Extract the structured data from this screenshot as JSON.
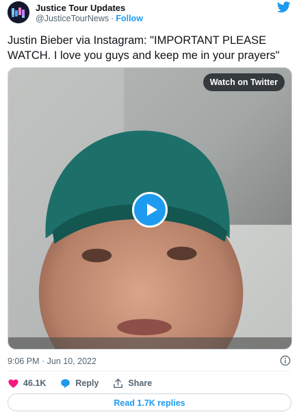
{
  "account": {
    "display_name": "Justice Tour Updates",
    "handle": "@JusticeTourNews",
    "separator": "·",
    "follow_label": "Follow",
    "avatar_icon": "justice-tour-logo"
  },
  "tweet": {
    "text": "Justin Bieber via Instagram: \"IMPORTANT PLEASE WATCH. I love you guys and keep me in your prayers\"",
    "timestamp": "9:06 PM · Jun 10, 2022"
  },
  "video": {
    "watch_label": "Watch on Twitter",
    "play_icon": "play-icon"
  },
  "actions": {
    "likes": "46.1K",
    "reply_label": "Reply",
    "share_label": "Share"
  },
  "read_replies_label": "Read 1.7K replies",
  "colors": {
    "accent": "#1d9bf0",
    "like": "#f91880",
    "text": "#0f1419",
    "muted": "#536471"
  }
}
